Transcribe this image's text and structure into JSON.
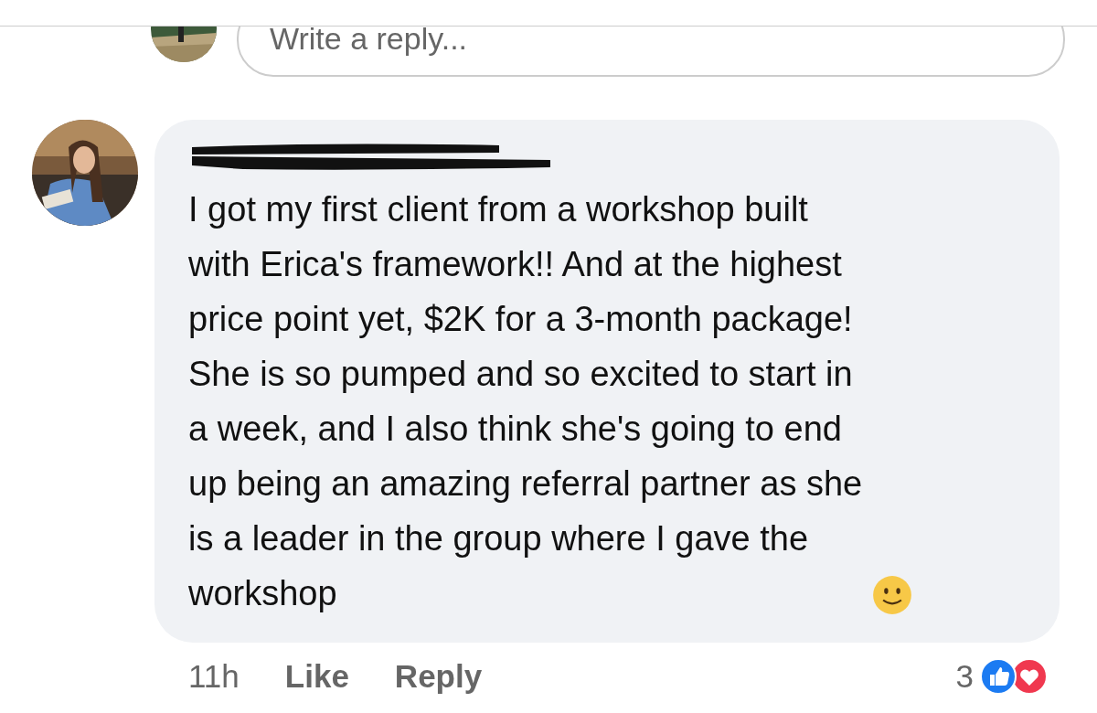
{
  "reply_box": {
    "placeholder": "Write a reply..."
  },
  "comment": {
    "author_redacted": true,
    "text": "I got my first client from a workshop built with Erica's framework!! And at the highest price point yet, $2K for a 3-month package! She is so pumped and so excited to start in a week, and I also think she's going to end up being an amazing referral partner as she is a leader in the group where I gave the workshop",
    "time": "11h",
    "actions": [
      "Like",
      "Reply"
    ],
    "reaction_count": "3"
  }
}
